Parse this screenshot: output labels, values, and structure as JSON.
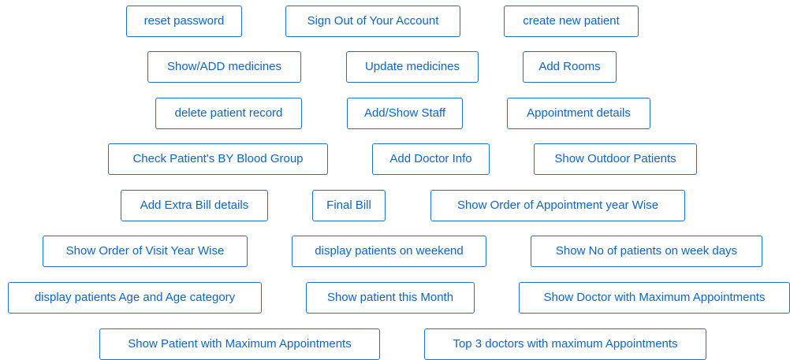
{
  "buttons": {
    "reset_password": "reset password",
    "sign_out": "Sign Out of Your Account",
    "create_new_patient": "create new patient",
    "show_add_medicines": "Show/ADD medicines",
    "update_medicines": "Update medicines",
    "add_rooms": "Add Rooms",
    "delete_patient_record": "delete patient record",
    "add_show_staff": "Add/Show Staff",
    "appointment_details": "Appointment details",
    "check_blood_group": "Check Patient's BY Blood Group",
    "add_doctor_info": "Add Doctor Info",
    "show_outdoor_patients": "Show Outdoor Patients",
    "add_extra_bill": "Add Extra Bill details",
    "final_bill": "Final Bill",
    "order_appointment_year": "Show Order of Appointment year Wise",
    "order_visit_year": "Show Order of Visit Year Wise",
    "patients_weekend": "display patients on weekend",
    "patients_week_days": "Show No of patients on week days",
    "patients_age_category": "display patients Age and Age category",
    "patient_this_month": "Show patient this Month",
    "doctor_max_appointments": "Show Doctor with Maximum Appointments",
    "patient_max_appointments": "Show Patient with Maximum Appointments",
    "top3_doctors": "Top 3 doctors with maximum Appointments"
  }
}
